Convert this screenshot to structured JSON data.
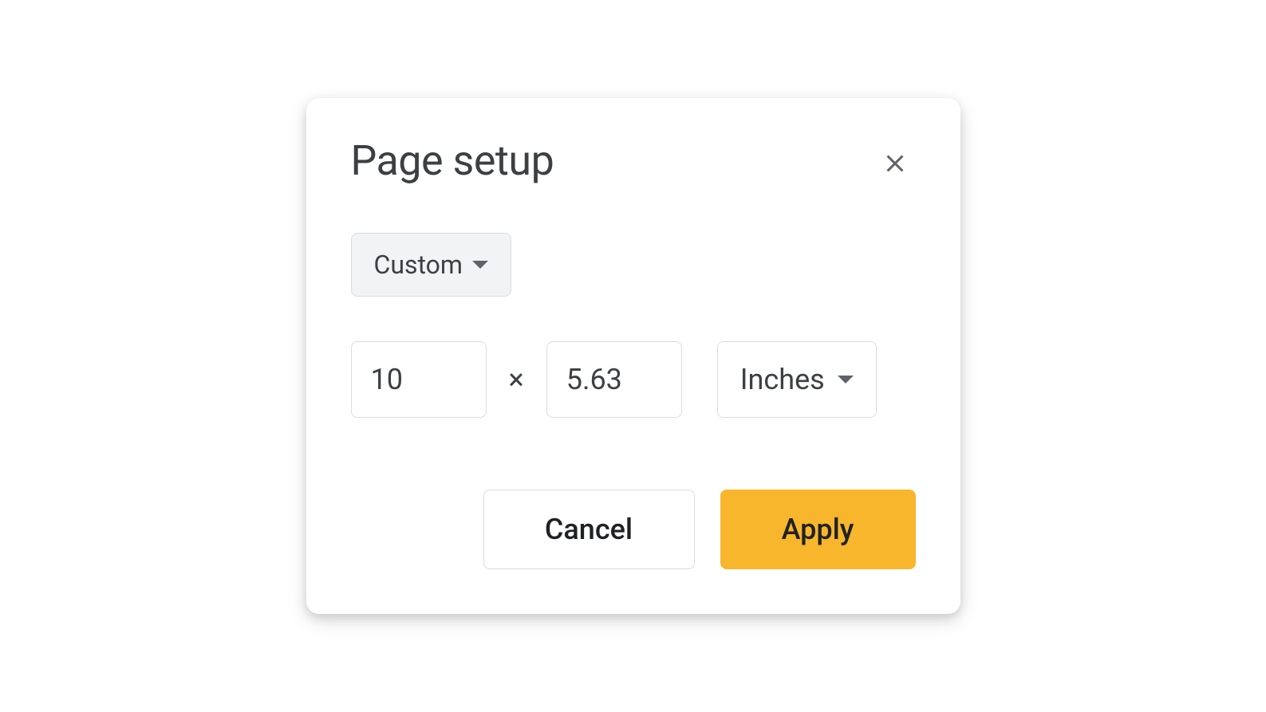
{
  "dialog": {
    "title": "Page setup",
    "close_icon": "close-icon"
  },
  "preset": {
    "selected": "Custom"
  },
  "dimensions": {
    "width": "10",
    "height": "5.63",
    "separator": "×"
  },
  "units": {
    "selected": "Inches"
  },
  "buttons": {
    "cancel": "Cancel",
    "apply": "Apply"
  },
  "colors": {
    "apply_bg": "#f8b62d",
    "text_primary": "#3c4043",
    "border": "#dadce0"
  }
}
